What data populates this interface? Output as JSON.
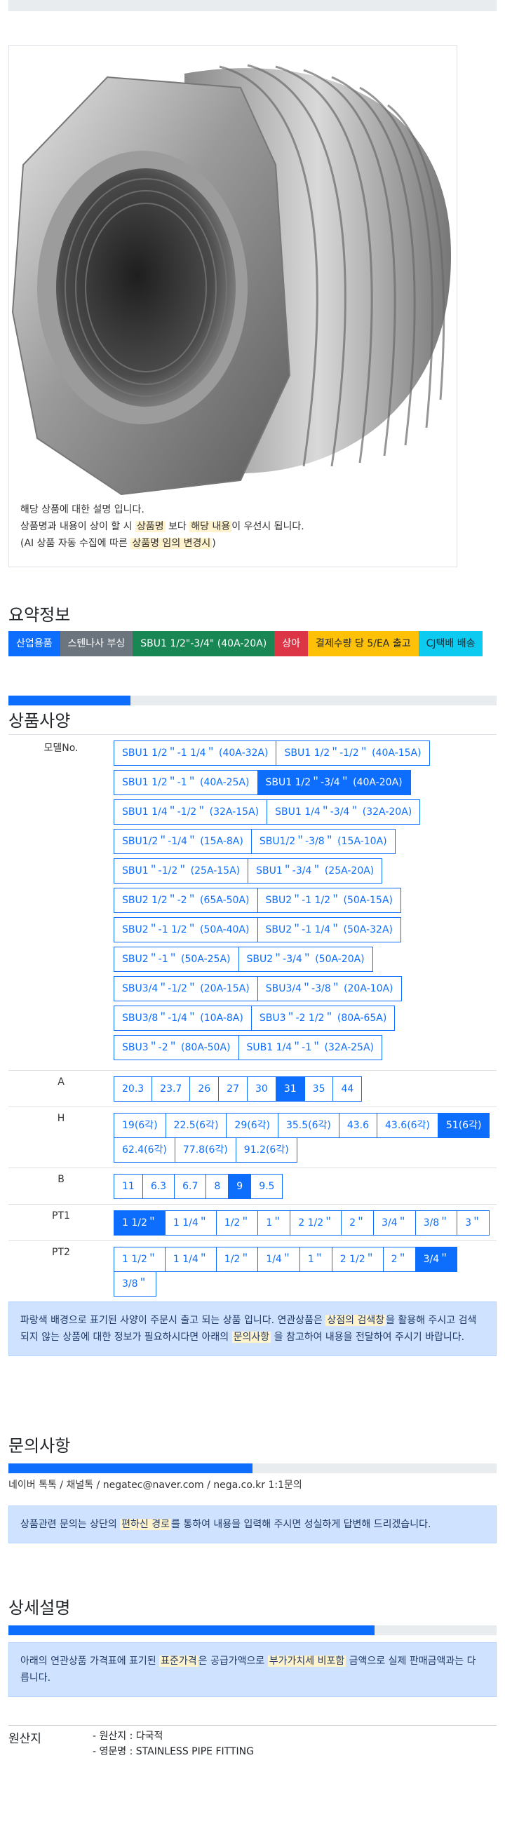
{
  "image_note": {
    "line1": "해당 상품에 대한 설명 입니다.",
    "line2_a": "상품명과 내용이 상이 할 시 ",
    "line2_hl1": "상품명",
    "line2_b": " 보다 ",
    "line2_hl2": "해당 내용",
    "line2_c": "이 우선시 됩니다.",
    "line3_a": "(AI 상품 자동 수집에 따른 ",
    "line3_hl": "상품명 임의 변경시",
    "line3_b": ")"
  },
  "summary": {
    "title": "요약정보",
    "badges": [
      "산업용품",
      "스텐나사 부싱",
      "SBU1 1/2\"-3/4\" (40A-20A)",
      "상아",
      "결제수량 당 5/EA 출고",
      "CJ택배 배송"
    ]
  },
  "spec": {
    "title": "상품사양",
    "progress": 0.25,
    "model_label": "모델No.",
    "models": [
      "SBU1 1/2＂-1 1/4＂ (40A-32A)",
      "SBU1 1/2＂-1/2＂ (40A-15A)",
      "SBU1 1/2＂-1＂ (40A-25A)",
      "SBU1 1/2＂-3/4＂ (40A-20A)",
      "SBU1 1/4＂-1/2＂ (32A-15A)",
      "SBU1 1/4＂-3/4＂ (32A-20A)",
      "SBU1/2＂-1/4＂ (15A-8A)",
      "SBU1/2＂-3/8＂ (15A-10A)",
      "SBU1＂-1/2＂ (25A-15A)",
      "SBU1＂-3/4＂ (25A-20A)",
      "SBU2 1/2＂-2＂ (65A-50A)",
      "SBU2＂-1 1/2＂ (50A-15A)",
      "SBU2＂-1 1/2＂ (50A-40A)",
      "SBU2＂-1 1/4＂ (50A-32A)",
      "SBU2＂-1＂ (50A-25A)",
      "SBU2＂-3/4＂ (50A-20A)",
      "SBU3/4＂-1/2＂ (20A-15A)",
      "SBU3/4＂-3/8＂ (20A-10A)",
      "SBU3/8＂-1/4＂ (10A-8A)",
      "SBU3＂-2 1/2＂ (80A-65A)",
      "SBU3＂-2＂ (80A-50A)",
      "SUB1 1/4＂-1＂ (32A-25A)"
    ],
    "models_selected": 3,
    "a_label": "A",
    "a_values": [
      "20.3",
      "23.7",
      "26",
      "27",
      "30",
      "31",
      "35",
      "44"
    ],
    "a_selected": 5,
    "h_label": "H",
    "h_values": [
      "19(6각)",
      "22.5(6각)",
      "29(6각)",
      "35.5(6각)",
      "43.6",
      "43.6(6각)",
      "51(6각)",
      "62.4(6각)",
      "77.8(6각)",
      "91.2(6각)"
    ],
    "h_selected": 6,
    "b_label": "B",
    "b_values": [
      "11",
      "6.3",
      "6.7",
      "8",
      "9",
      "9.5"
    ],
    "b_selected": 4,
    "pt1_label": "PT1",
    "pt1_values": [
      "1 1/2＂",
      "1 1/4＂",
      "1/2＂",
      "1＂",
      "2 1/2＂",
      "2＂",
      "3/4＂",
      "3/8＂",
      "3＂"
    ],
    "pt1_selected": 0,
    "pt2_label": "PT2",
    "pt2_values": [
      "1 1/2＂",
      "1 1/4＂",
      "1/2＂",
      "1/4＂",
      "1＂",
      "2 1/2＂",
      "2＂",
      "3/4＂",
      "3/8＂"
    ],
    "pt2_selected": 7,
    "notice_a": "파랑색 배경으로 표기된 사양이 주문시 출고 되는 상품 입니다. 연관상품은 ",
    "notice_hl1": "상점의 검색창",
    "notice_b": "을 활용해 주시고 검색되지 않는 상품에 대한 정보가 필요하시다면 아래의 ",
    "notice_hl2": "문의사항",
    "notice_c": " 을 참고하여 내용을 전달하여 주시기 바랍니다."
  },
  "inquiry": {
    "title": "문의사항",
    "progress": 0.5,
    "links": "네이버 톡톡 /  채널톡 /  negatec@naver.com /  nega.co.kr 1:1문의",
    "notice_a": "상품관련 문의는 상단의 ",
    "notice_hl": "편하신 경로",
    "notice_b": "를 통하여 내용을 입력해 주시면 성실하게 답변해 드리겠습니다."
  },
  "detail": {
    "title": "상세설명",
    "progress": 0.75,
    "notice_a": "아래의 연관상품 가격표에 표기된 ",
    "notice_hl1": "표준가격",
    "notice_b": "은 공급가액으로 ",
    "notice_hl2": "부가가치세 비포함",
    "notice_c": " 금액으로 실제 판매금액과는 다릅니다.",
    "origin_label": "원산지",
    "origin_line1": "- 원산지 : 다국적",
    "origin_line2": "- 영문명 : STAINLESS PIPE FITTING"
  },
  "colors": {
    "primary": "#0d6efd",
    "highlight": "#fff3cd",
    "alert_bg": "#cfe2ff"
  }
}
